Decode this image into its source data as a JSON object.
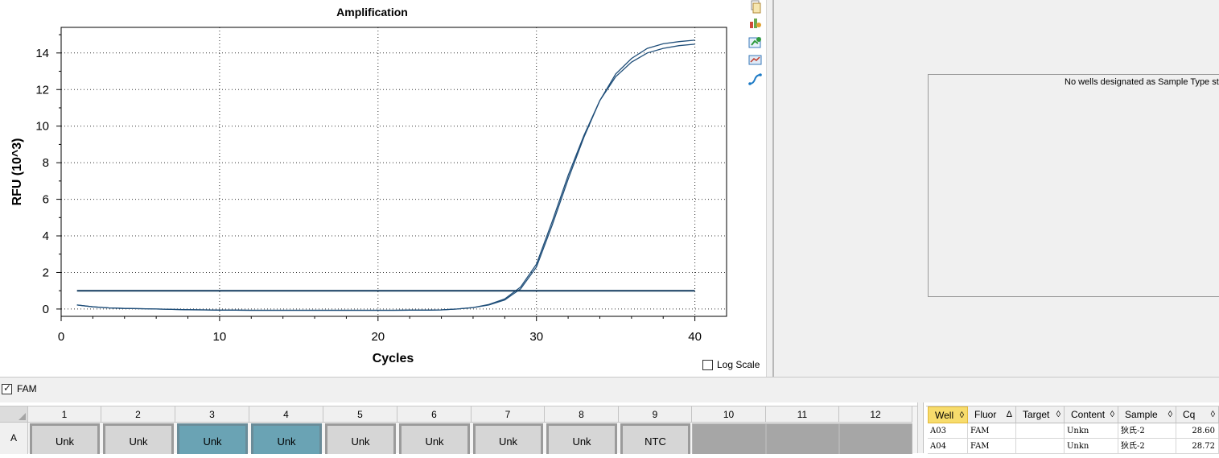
{
  "chart_data": {
    "type": "line",
    "title": "Amplification",
    "xlabel": "Cycles",
    "ylabel": "RFU (10^3)",
    "xlim": [
      0,
      42
    ],
    "ylim": [
      -0.4,
      15.4
    ],
    "xticks": [
      0,
      10,
      20,
      30,
      40
    ],
    "yticks": [
      0,
      2,
      4,
      6,
      8,
      10,
      12,
      14
    ],
    "grid": true,
    "threshold": 1.0,
    "series": [
      {
        "x": [
          1,
          2,
          3,
          4,
          5,
          6,
          7,
          8,
          9,
          10,
          11,
          12,
          13,
          14,
          15,
          16,
          17,
          18,
          19,
          20,
          21,
          22,
          23,
          24,
          25,
          26,
          27,
          28,
          29,
          30,
          31,
          32,
          33,
          34,
          35,
          36,
          37,
          38,
          39,
          40
        ],
        "values": [
          0.22,
          0.12,
          0.06,
          0.03,
          0.02,
          0.0,
          -0.02,
          -0.04,
          -0.05,
          -0.06,
          -0.06,
          -0.07,
          -0.07,
          -0.07,
          -0.07,
          -0.07,
          -0.07,
          -0.07,
          -0.07,
          -0.07,
          -0.07,
          -0.06,
          -0.06,
          -0.05,
          0.0,
          0.08,
          0.25,
          0.55,
          1.2,
          2.45,
          4.8,
          7.3,
          9.5,
          11.4,
          12.7,
          13.5,
          14.0,
          14.25,
          14.4,
          14.48
        ],
        "color": "#1f4e79"
      },
      {
        "x": [
          1,
          2,
          3,
          4,
          5,
          6,
          7,
          8,
          9,
          10,
          11,
          12,
          13,
          14,
          15,
          16,
          17,
          18,
          19,
          20,
          21,
          22,
          23,
          24,
          25,
          26,
          27,
          28,
          29,
          30,
          31,
          32,
          33,
          34,
          35,
          36,
          37,
          38,
          39,
          40
        ],
        "values": [
          0.22,
          0.12,
          0.06,
          0.03,
          0.02,
          0.0,
          -0.02,
          -0.04,
          -0.05,
          -0.06,
          -0.06,
          -0.07,
          -0.07,
          -0.07,
          -0.07,
          -0.07,
          -0.07,
          -0.07,
          -0.07,
          -0.07,
          -0.07,
          -0.06,
          -0.06,
          -0.05,
          0.0,
          0.08,
          0.22,
          0.5,
          1.1,
          2.3,
          4.6,
          7.1,
          9.4,
          11.4,
          12.85,
          13.7,
          14.25,
          14.5,
          14.62,
          14.7
        ],
        "color": "#1f4e79"
      }
    ]
  },
  "chart_options": {
    "log_scale_label": "Log Scale",
    "log_scale_checked": false
  },
  "toolbar_icons": [
    "copy-icon",
    "export-icon",
    "add-chart-icon",
    "chart-settings-icon",
    "curve-icon"
  ],
  "standard_curve": {
    "message": "No wells designated as Sample Type standard"
  },
  "fluorophores": [
    {
      "label": "FAM",
      "checked": true
    }
  ],
  "plate": {
    "columns": [
      "1",
      "2",
      "3",
      "4",
      "5",
      "6",
      "7",
      "8",
      "9",
      "10",
      "11",
      "12"
    ],
    "rows": [
      {
        "label": "A",
        "wells": [
          {
            "text": "Unk",
            "state": "std"
          },
          {
            "text": "Unk",
            "state": "std"
          },
          {
            "text": "Unk",
            "state": "sel"
          },
          {
            "text": "Unk",
            "state": "sel"
          },
          {
            "text": "Unk",
            "state": "std"
          },
          {
            "text": "Unk",
            "state": "std"
          },
          {
            "text": "Unk",
            "state": "std"
          },
          {
            "text": "Unk",
            "state": "std"
          },
          {
            "text": "NTC",
            "state": "std"
          },
          {
            "text": "",
            "state": "empty"
          },
          {
            "text": "",
            "state": "empty"
          },
          {
            "text": "",
            "state": "empty"
          }
        ]
      }
    ]
  },
  "wells_table": {
    "headers": [
      {
        "label": "Well",
        "sort": "◊",
        "highlight": true
      },
      {
        "label": "Fluor",
        "sort": "Δ",
        "highlight": false
      },
      {
        "label": "Target",
        "sort": "◊",
        "highlight": false
      },
      {
        "label": "Content",
        "sort": "◊",
        "highlight": false
      },
      {
        "label": "Sample",
        "sort": "◊",
        "highlight": false
      },
      {
        "label": "Cq",
        "sort": "◊",
        "highlight": false
      }
    ],
    "rows": [
      [
        "A03",
        "FAM",
        "",
        "Unkn",
        "狄氏-2",
        "28.60"
      ],
      [
        "A04",
        "FAM",
        "",
        "Unkn",
        "狄氏-2",
        "28.72"
      ]
    ]
  }
}
